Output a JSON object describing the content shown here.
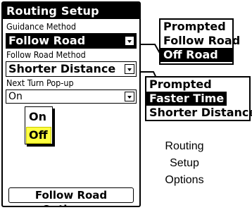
{
  "window": {
    "title": "Routing Setup"
  },
  "guidance": {
    "label": "Guidance Method",
    "value": "Follow Road",
    "options": [
      "Prompted",
      "Follow Road",
      "Off Road"
    ],
    "selected_option": "Off Road"
  },
  "follow_road_method": {
    "label": "Follow Road Method",
    "value": "Shorter Distance",
    "options": [
      "Prompted",
      "Faster Time",
      "Shorter Distance"
    ],
    "selected_option": "Faster Time"
  },
  "next_turn": {
    "label": "Next Turn Pop-up",
    "value": "On",
    "options": [
      "On",
      "Off"
    ],
    "highlighted_option": "Off"
  },
  "buttons": {
    "follow_road_options": "Follow Road Options..."
  },
  "caption": {
    "line1": "Routing",
    "line2": "Setup",
    "line3": "Options"
  },
  "colors": {
    "highlight": "#ffff40",
    "selection": "#000000",
    "background": "#ffffff"
  },
  "icons": {
    "dropdown": "chevron-down-icon"
  }
}
